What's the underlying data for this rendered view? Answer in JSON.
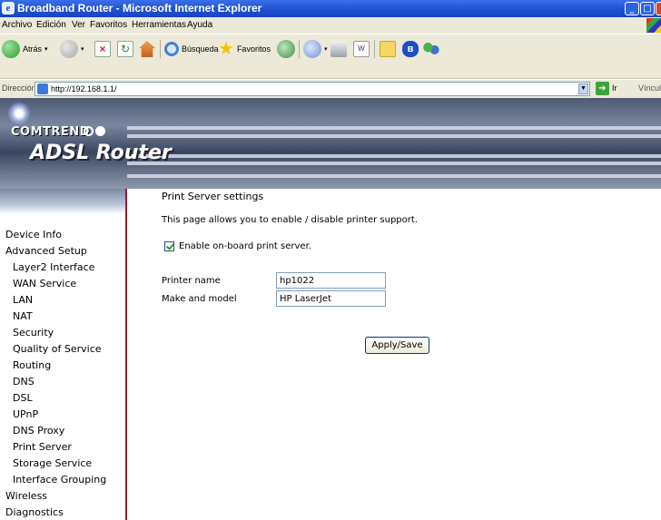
{
  "window": {
    "title": "Broadband Router - Microsoft Internet Explorer"
  },
  "menubar": {
    "items": [
      "Archivo",
      "Edición",
      "Ver",
      "Favoritos",
      "Herramientas",
      "Ayuda"
    ]
  },
  "toolbar": {
    "back_label": "Atrás",
    "search_label": "Búsqueda",
    "favorites_label": "Favoritos"
  },
  "addressbar": {
    "label": "Dirección",
    "url": "http://192.168.1.1/",
    "go_label": "Ir",
    "links_label": "Vínculos"
  },
  "banner": {
    "brand": "COMTREND",
    "product": "ADSL Router"
  },
  "nav": {
    "items": [
      {
        "label": "Device Info",
        "level": 1
      },
      {
        "label": "Advanced Setup",
        "level": 1
      },
      {
        "label": "Layer2 Interface",
        "level": 2
      },
      {
        "label": "WAN Service",
        "level": 2
      },
      {
        "label": "LAN",
        "level": 2
      },
      {
        "label": "NAT",
        "level": 2
      },
      {
        "label": "Security",
        "level": 2
      },
      {
        "label": "Quality of Service",
        "level": 2
      },
      {
        "label": "Routing",
        "level": 2
      },
      {
        "label": "DNS",
        "level": 2
      },
      {
        "label": "DSL",
        "level": 2
      },
      {
        "label": "UPnP",
        "level": 2
      },
      {
        "label": "DNS Proxy",
        "level": 2
      },
      {
        "label": "Print Server",
        "level": 2
      },
      {
        "label": "Storage Service",
        "level": 2
      },
      {
        "label": "Interface Grouping",
        "level": 2
      },
      {
        "label": "Wireless",
        "level": 1
      },
      {
        "label": "Diagnostics",
        "level": 1
      }
    ]
  },
  "main": {
    "title": "Print Server settings",
    "description": "This page allows you to enable / disable printer support.",
    "enable_checkbox": {
      "label": "Enable on-board print server.",
      "checked": true
    },
    "printer_name": {
      "label": "Printer name",
      "value": "hp1022"
    },
    "make_model": {
      "label": "Make and model",
      "value": "HP LaserJet"
    },
    "apply_button": "Apply/Save"
  }
}
